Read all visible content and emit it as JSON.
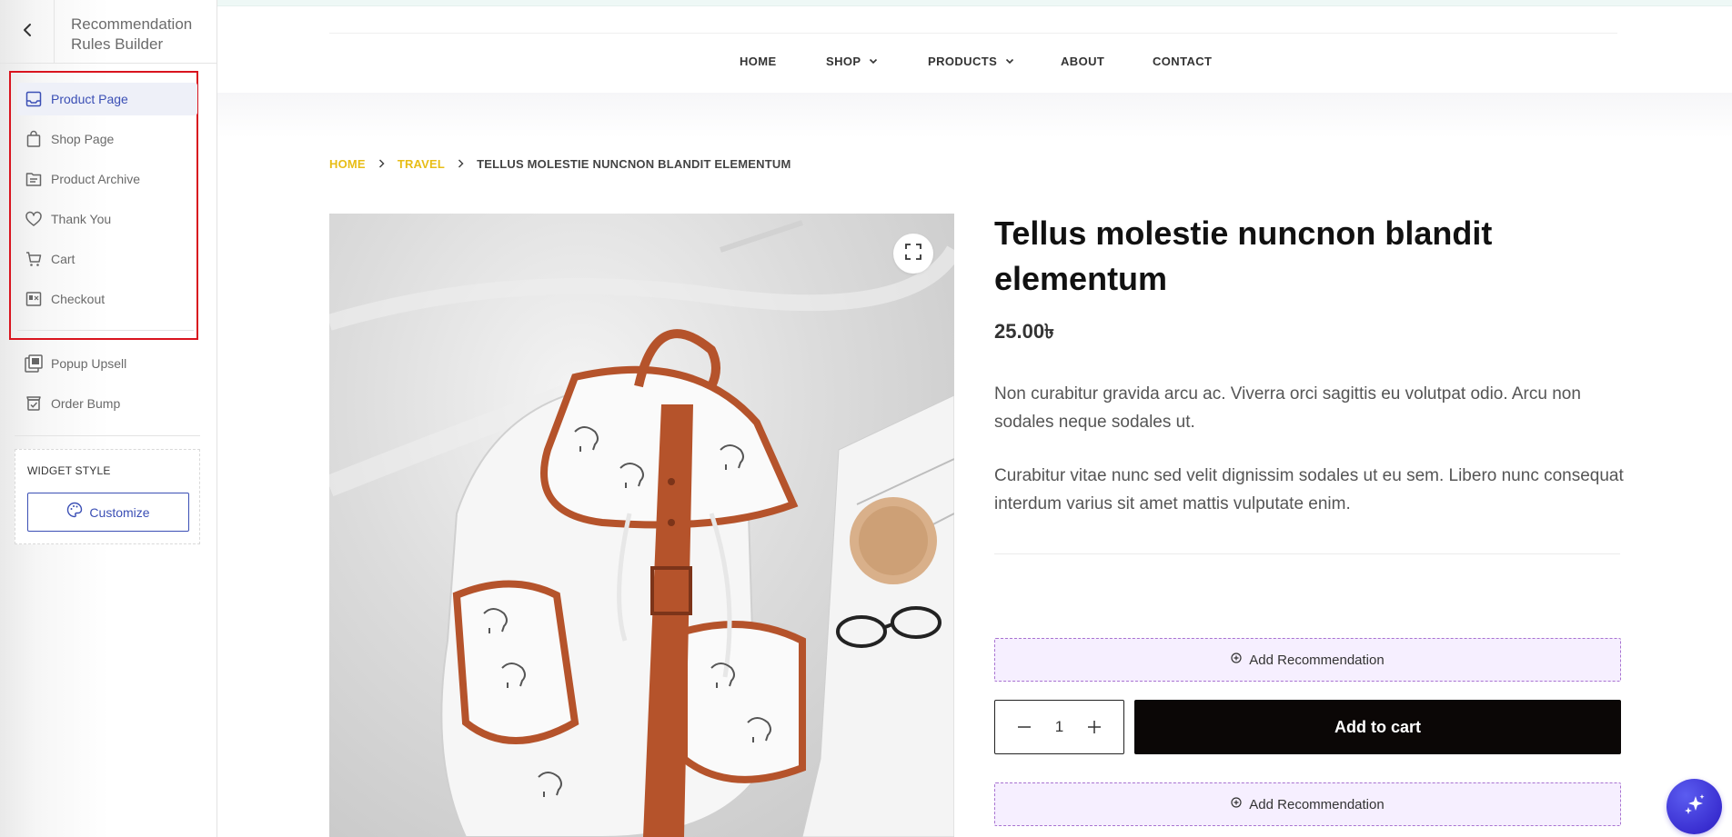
{
  "sidebar": {
    "title": "Recommendation Rules Builder",
    "items": [
      {
        "label": "Product Page",
        "icon": "product-page-icon"
      },
      {
        "label": "Shop Page",
        "icon": "shopping-bag-icon"
      },
      {
        "label": "Product Archive",
        "icon": "archive-icon"
      },
      {
        "label": "Thank You",
        "icon": "heart-icon"
      },
      {
        "label": "Cart",
        "icon": "cart-icon"
      },
      {
        "label": "Checkout",
        "icon": "checkout-icon"
      },
      {
        "label": "Popup Upsell",
        "icon": "popup-icon"
      },
      {
        "label": "Order Bump",
        "icon": "order-bump-icon"
      }
    ],
    "widget_style": {
      "title": "WIDGET STYLE",
      "customize_label": "Customize"
    },
    "active_color": "#3b4fb5",
    "highlight_color": "#d9141e"
  },
  "nav": {
    "home": "HOME",
    "shop": "SHOP",
    "products": "PRODUCTS",
    "about": "ABOUT",
    "contact": "CONTACT"
  },
  "breadcrumb": {
    "home": "HOME",
    "travel": "TRAVEL",
    "current": "TELLUS MOLESTIE NUNCNON BLANDIT ELEMENTUM",
    "link_color": "#e8bd16"
  },
  "product": {
    "title": "Tellus molestie nuncnon blandit elementum",
    "price": "25.00৳",
    "desc1": "Non curabitur gravida arcu ac. Viverra orci sagittis eu volutpat odio. Arcu non sodales neque sodales ut.",
    "desc2": "Curabitur vitae nunc sed velit dignissim sodales ut eu sem. Libero nunc consequat interdum varius sit amet mattis vulputate enim.",
    "add_recommendation": "Add Recommendation",
    "quantity": "1",
    "add_to_cart": "Add to cart"
  }
}
